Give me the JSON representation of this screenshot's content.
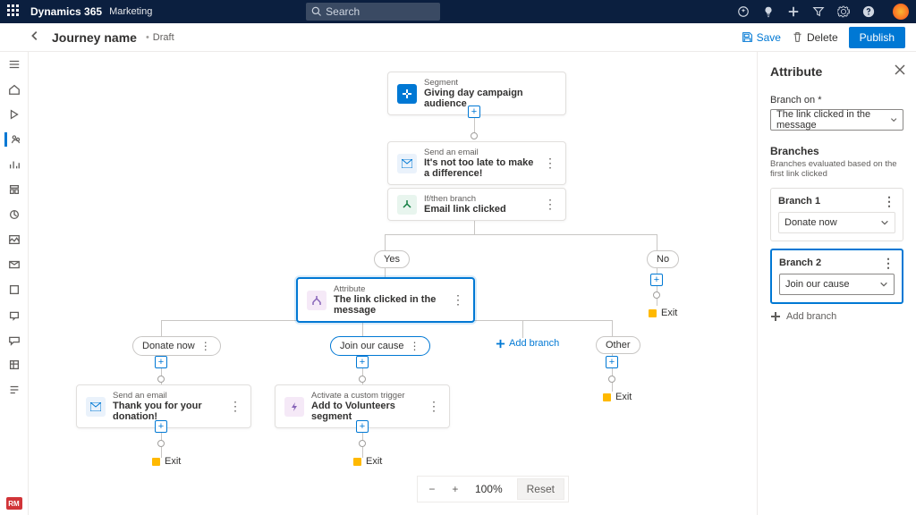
{
  "topbar": {
    "brand": "Dynamics 365",
    "module": "Marketing",
    "search_placeholder": "Search"
  },
  "header": {
    "title": "Journey name",
    "status": "Draft",
    "save": "Save",
    "delete": "Delete",
    "publish": "Publish"
  },
  "leftnav": {
    "rm": "RM"
  },
  "canvas": {
    "segment": {
      "small": "Segment",
      "main": "Giving day campaign audience"
    },
    "email1": {
      "small": "Send an email",
      "main": "It's not too late to make a difference!"
    },
    "branch1": {
      "small": "If/then branch",
      "main": "Email link clicked"
    },
    "yes": "Yes",
    "no": "No",
    "attribute": {
      "small": "Attribute",
      "main": "The link clicked in the message"
    },
    "pill_donate": "Donate now",
    "pill_join": "Join our cause",
    "pill_other": "Other",
    "add_branch": "Add branch",
    "email2": {
      "small": "Send an email",
      "main": "Thank you for your donation!"
    },
    "trigger": {
      "small": "Activate a custom trigger",
      "main": "Add to Volunteers segment"
    },
    "exit": "Exit"
  },
  "zoom": {
    "value": "100%",
    "reset": "Reset"
  },
  "panel": {
    "title": "Attribute",
    "branch_on_label": "Branch on *",
    "branch_on_value": "The link clicked in the message",
    "branches_label": "Branches",
    "branches_hint": "Branches evaluated based on the first link clicked",
    "branch1_label": "Branch 1",
    "branch1_value": "Donate now",
    "branch2_label": "Branch 2",
    "branch2_value": "Join our cause",
    "add_branch": "Add branch"
  }
}
